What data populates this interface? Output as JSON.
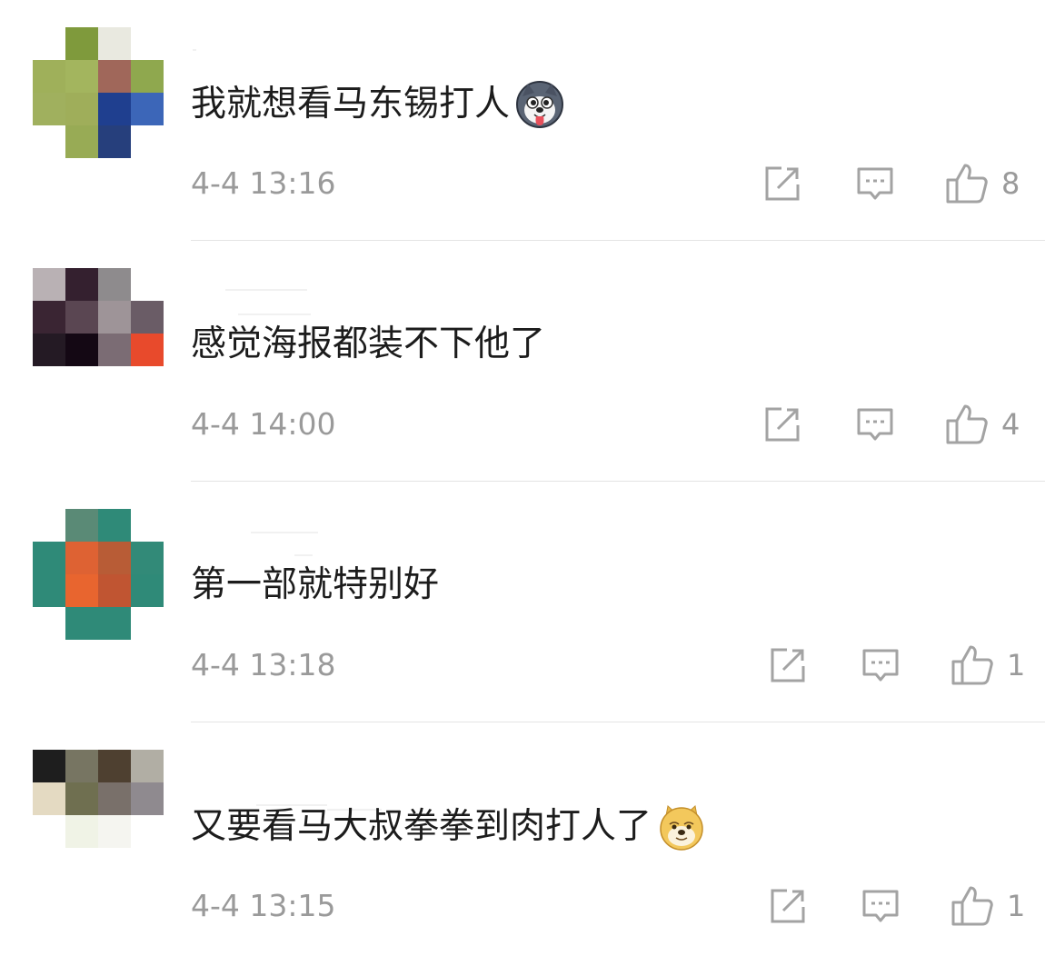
{
  "comments": [
    {
      "text": "我就想看马东锡打人",
      "emoji": "husky-emoji",
      "time": "4-4 13:16",
      "likes": "8",
      "avatar": [
        [
          null,
          "#7f9a3c",
          "#e9e9e0",
          null
        ],
        [
          "#9fb05a",
          "#a3b55e",
          "#a0675a",
          "#8fa84e"
        ],
        [
          "#a0b05e",
          "#9fae5a",
          "#1f3f8f",
          "#3c66b8"
        ],
        [
          null,
          "#98ab55",
          "#263f7c",
          null
        ]
      ]
    },
    {
      "text": "感觉海报都装不下他了",
      "emoji": null,
      "time": "4-4 14:00",
      "likes": "4",
      "avatar": [
        [
          "#b9b1b4",
          "#34202f",
          "#8e8b8d",
          null
        ],
        [
          "#3a2533",
          "#5a4652",
          "#9e9498",
          "#6a5c66"
        ],
        [
          "#241a24",
          "#140814",
          "#7b6c74",
          "#e84a2c"
        ],
        [
          null,
          null,
          null,
          null
        ]
      ]
    },
    {
      "text": "第一部就特别好",
      "emoji": null,
      "time": "4-4 13:18",
      "likes": "1",
      "avatar": [
        [
          null,
          "#5a8a76",
          "#2f8a78",
          null
        ],
        [
          "#2f8a78",
          "#de6233",
          "#b85c36",
          "#328a78"
        ],
        [
          "#2f8a78",
          "#e8652f",
          "#c05532",
          "#2f8a78"
        ],
        [
          null,
          "#2f8a78",
          "#2f8a78",
          null
        ]
      ]
    },
    {
      "text": "又要看马大叔拳拳到肉打人了",
      "emoji": "doge-emoji",
      "time": "4-4 13:15",
      "likes": "1",
      "avatar": [
        [
          "#1e1e1e",
          "#777562",
          "#4e4030",
          "#b1aea4"
        ],
        [
          "#e4dac2",
          "#6f6f50",
          "#79706a",
          "#8f8a8f"
        ],
        [
          null,
          "#f0f3e6",
          "#f5f5f0",
          null
        ],
        [
          null,
          null,
          null,
          null
        ]
      ]
    }
  ]
}
